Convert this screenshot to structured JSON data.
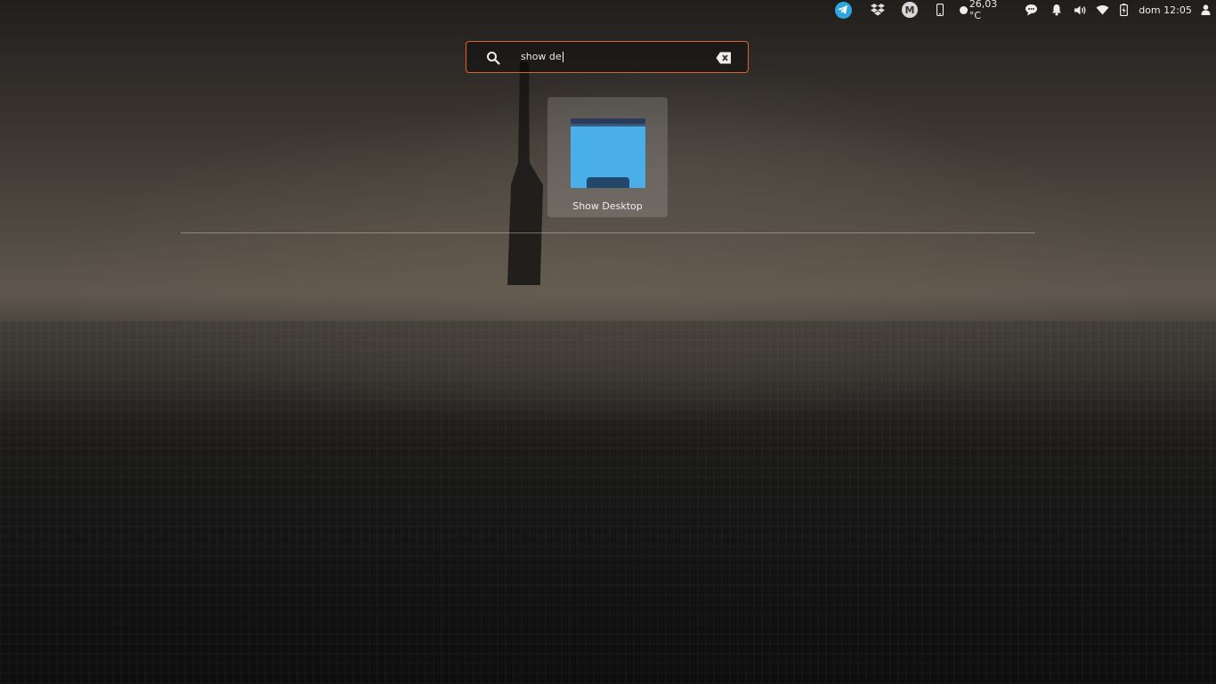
{
  "topbar": {
    "weather": "26,03 °C",
    "clock": "dom 12:05",
    "tray_icons": [
      "telegram-icon",
      "dropbox-icon",
      "mega-icon",
      "phone-icon",
      "weather-icon",
      "chat-icon",
      "bell-icon",
      "volume-icon",
      "wifi-icon",
      "battery-icon",
      "user-icon"
    ],
    "mega_letter": "M"
  },
  "search": {
    "query": "show de",
    "accent_color": "#e0602f"
  },
  "results": [
    {
      "label": "Show Desktop",
      "icon": "folder-desktop-icon",
      "icon_color": "#4aaee8"
    }
  ]
}
